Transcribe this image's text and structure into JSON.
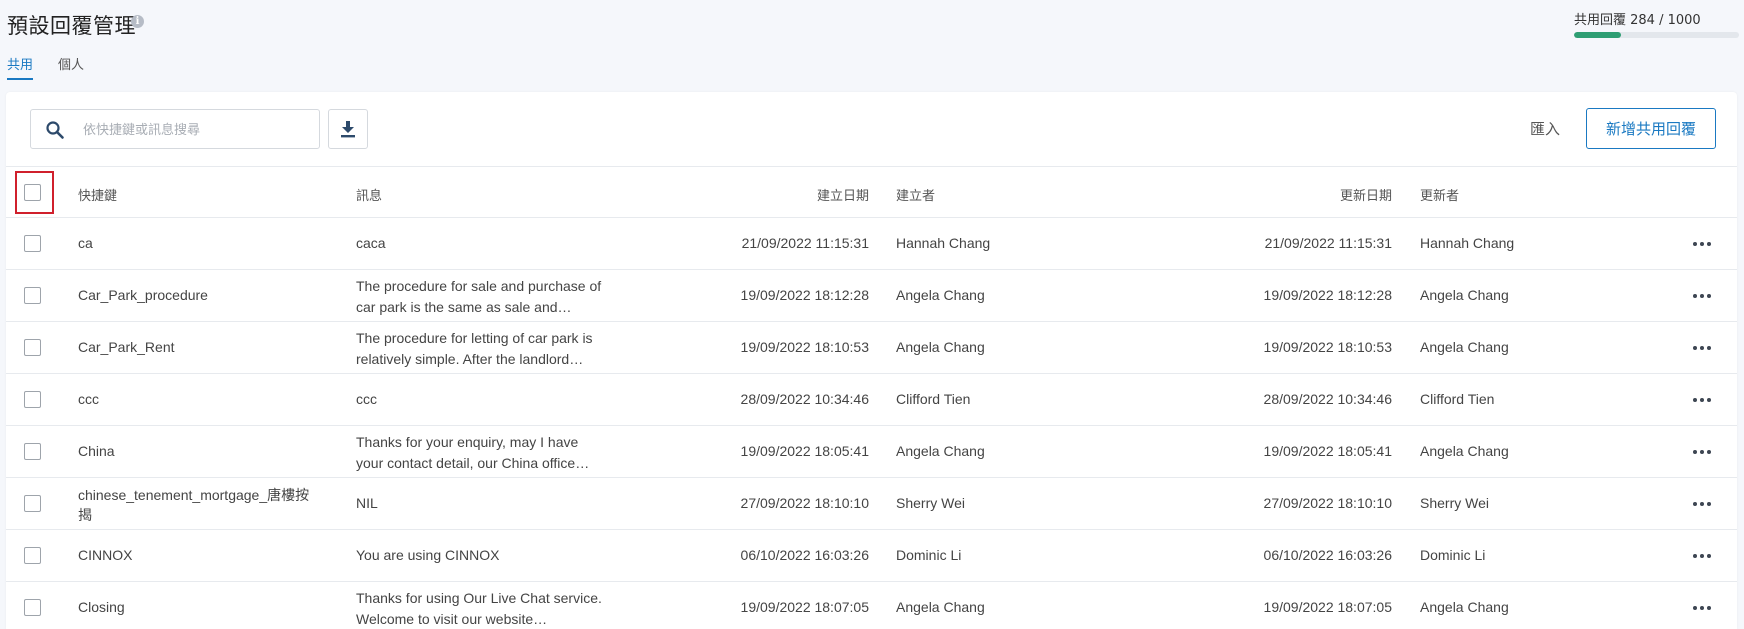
{
  "header": {
    "title": "預設回覆管理",
    "info_icon": "info-icon",
    "tabs": [
      {
        "label": "共用",
        "active": true
      },
      {
        "label": "個人",
        "active": false
      }
    ],
    "quota": {
      "label": "共用回覆 284 / 1000",
      "used": 284,
      "total": 1000,
      "color": "#2e9e73"
    }
  },
  "toolbar": {
    "search_placeholder": "依快捷鍵或訊息搜尋",
    "search_value": "",
    "download_icon": "download-icon",
    "import_label": "匯入",
    "new_label": "新增共用回覆",
    "accent": "#1a79c2"
  },
  "table": {
    "columns": {
      "shortcut": "快捷鍵",
      "message": "訊息",
      "created_date": "建立日期",
      "creator": "建立者",
      "updated_date": "更新日期",
      "updater": "更新者"
    },
    "rows": [
      {
        "shortcut": "ca",
        "message": "caca",
        "created": "21/09/2022 11:15:31",
        "creator": "Hannah Chang",
        "updated": "21/09/2022 11:15:31",
        "updater": "Hannah Chang"
      },
      {
        "shortcut": "Car_Park_procedure",
        "message": "The procedure for sale and purchase of car park is the same as sale and…",
        "created": "19/09/2022 18:12:28",
        "creator": "Angela Chang",
        "updated": "19/09/2022 18:12:28",
        "updater": "Angela Chang"
      },
      {
        "shortcut": "Car_Park_Rent",
        "message": "The procedure for letting of car park is relatively simple. After the landlord…",
        "created": "19/09/2022 18:10:53",
        "creator": "Angela Chang",
        "updated": "19/09/2022 18:10:53",
        "updater": "Angela Chang"
      },
      {
        "shortcut": "ccc",
        "message": "ccc",
        "created": "28/09/2022 10:34:46",
        "creator": "Clifford Tien",
        "updated": "28/09/2022 10:34:46",
        "updater": "Clifford Tien"
      },
      {
        "shortcut": "China",
        "message": "Thanks for your enquiry, may I have your contact detail, our China office…",
        "created": "19/09/2022 18:05:41",
        "creator": "Angela Chang",
        "updated": "19/09/2022 18:05:41",
        "updater": "Angela Chang"
      },
      {
        "shortcut": "chinese_tenement_mortgage_唐樓按揭",
        "message": "NIL",
        "created": "27/09/2022 18:10:10",
        "creator": "Sherry Wei",
        "updated": "27/09/2022 18:10:10",
        "updater": "Sherry Wei"
      },
      {
        "shortcut": "CINNOX",
        "message": "You are using CINNOX",
        "created": "06/10/2022 16:03:26",
        "creator": "Dominic Li",
        "updated": "06/10/2022 16:03:26",
        "updater": "Dominic Li"
      },
      {
        "shortcut": "Closing",
        "message": "Thanks for using Our Live Chat service. Welcome to visit our website…",
        "created": "19/09/2022 18:07:05",
        "creator": "Angela Chang",
        "updated": "19/09/2022 18:07:05",
        "updater": "Angela Chang"
      }
    ]
  }
}
